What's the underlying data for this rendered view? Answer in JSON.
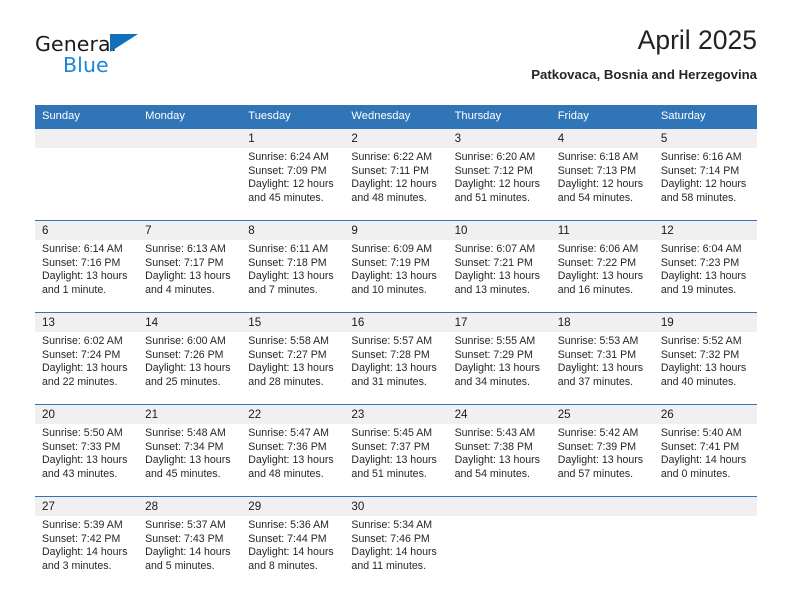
{
  "brand": {
    "name_part1": "General",
    "name_part2": "Blue",
    "triangle_icon": "triangle-icon",
    "blue_hex": "#1b86d8",
    "dark_hex": "#1b1b1b"
  },
  "header": {
    "title": "April 2025",
    "subtitle": "Patkovaca, Bosnia and Herzegovina",
    "header_bg_hex": "#3075b8",
    "daynum_bg_hex": "#f0f0f0"
  },
  "weekdays": [
    "Sunday",
    "Monday",
    "Tuesday",
    "Wednesday",
    "Thursday",
    "Friday",
    "Saturday"
  ],
  "weeks": [
    [
      {
        "day": "",
        "sunrise": "",
        "sunset": "",
        "daylight": ""
      },
      {
        "day": "",
        "sunrise": "",
        "sunset": "",
        "daylight": ""
      },
      {
        "day": "1",
        "sunrise": "Sunrise: 6:24 AM",
        "sunset": "Sunset: 7:09 PM",
        "daylight": "Daylight: 12 hours and 45 minutes."
      },
      {
        "day": "2",
        "sunrise": "Sunrise: 6:22 AM",
        "sunset": "Sunset: 7:11 PM",
        "daylight": "Daylight: 12 hours and 48 minutes."
      },
      {
        "day": "3",
        "sunrise": "Sunrise: 6:20 AM",
        "sunset": "Sunset: 7:12 PM",
        "daylight": "Daylight: 12 hours and 51 minutes."
      },
      {
        "day": "4",
        "sunrise": "Sunrise: 6:18 AM",
        "sunset": "Sunset: 7:13 PM",
        "daylight": "Daylight: 12 hours and 54 minutes."
      },
      {
        "day": "5",
        "sunrise": "Sunrise: 6:16 AM",
        "sunset": "Sunset: 7:14 PM",
        "daylight": "Daylight: 12 hours and 58 minutes."
      }
    ],
    [
      {
        "day": "6",
        "sunrise": "Sunrise: 6:14 AM",
        "sunset": "Sunset: 7:16 PM",
        "daylight": "Daylight: 13 hours and 1 minute."
      },
      {
        "day": "7",
        "sunrise": "Sunrise: 6:13 AM",
        "sunset": "Sunset: 7:17 PM",
        "daylight": "Daylight: 13 hours and 4 minutes."
      },
      {
        "day": "8",
        "sunrise": "Sunrise: 6:11 AM",
        "sunset": "Sunset: 7:18 PM",
        "daylight": "Daylight: 13 hours and 7 minutes."
      },
      {
        "day": "9",
        "sunrise": "Sunrise: 6:09 AM",
        "sunset": "Sunset: 7:19 PM",
        "daylight": "Daylight: 13 hours and 10 minutes."
      },
      {
        "day": "10",
        "sunrise": "Sunrise: 6:07 AM",
        "sunset": "Sunset: 7:21 PM",
        "daylight": "Daylight: 13 hours and 13 minutes."
      },
      {
        "day": "11",
        "sunrise": "Sunrise: 6:06 AM",
        "sunset": "Sunset: 7:22 PM",
        "daylight": "Daylight: 13 hours and 16 minutes."
      },
      {
        "day": "12",
        "sunrise": "Sunrise: 6:04 AM",
        "sunset": "Sunset: 7:23 PM",
        "daylight": "Daylight: 13 hours and 19 minutes."
      }
    ],
    [
      {
        "day": "13",
        "sunrise": "Sunrise: 6:02 AM",
        "sunset": "Sunset: 7:24 PM",
        "daylight": "Daylight: 13 hours and 22 minutes."
      },
      {
        "day": "14",
        "sunrise": "Sunrise: 6:00 AM",
        "sunset": "Sunset: 7:26 PM",
        "daylight": "Daylight: 13 hours and 25 minutes."
      },
      {
        "day": "15",
        "sunrise": "Sunrise: 5:58 AM",
        "sunset": "Sunset: 7:27 PM",
        "daylight": "Daylight: 13 hours and 28 minutes."
      },
      {
        "day": "16",
        "sunrise": "Sunrise: 5:57 AM",
        "sunset": "Sunset: 7:28 PM",
        "daylight": "Daylight: 13 hours and 31 minutes."
      },
      {
        "day": "17",
        "sunrise": "Sunrise: 5:55 AM",
        "sunset": "Sunset: 7:29 PM",
        "daylight": "Daylight: 13 hours and 34 minutes."
      },
      {
        "day": "18",
        "sunrise": "Sunrise: 5:53 AM",
        "sunset": "Sunset: 7:31 PM",
        "daylight": "Daylight: 13 hours and 37 minutes."
      },
      {
        "day": "19",
        "sunrise": "Sunrise: 5:52 AM",
        "sunset": "Sunset: 7:32 PM",
        "daylight": "Daylight: 13 hours and 40 minutes."
      }
    ],
    [
      {
        "day": "20",
        "sunrise": "Sunrise: 5:50 AM",
        "sunset": "Sunset: 7:33 PM",
        "daylight": "Daylight: 13 hours and 43 minutes."
      },
      {
        "day": "21",
        "sunrise": "Sunrise: 5:48 AM",
        "sunset": "Sunset: 7:34 PM",
        "daylight": "Daylight: 13 hours and 45 minutes."
      },
      {
        "day": "22",
        "sunrise": "Sunrise: 5:47 AM",
        "sunset": "Sunset: 7:36 PM",
        "daylight": "Daylight: 13 hours and 48 minutes."
      },
      {
        "day": "23",
        "sunrise": "Sunrise: 5:45 AM",
        "sunset": "Sunset: 7:37 PM",
        "daylight": "Daylight: 13 hours and 51 minutes."
      },
      {
        "day": "24",
        "sunrise": "Sunrise: 5:43 AM",
        "sunset": "Sunset: 7:38 PM",
        "daylight": "Daylight: 13 hours and 54 minutes."
      },
      {
        "day": "25",
        "sunrise": "Sunrise: 5:42 AM",
        "sunset": "Sunset: 7:39 PM",
        "daylight": "Daylight: 13 hours and 57 minutes."
      },
      {
        "day": "26",
        "sunrise": "Sunrise: 5:40 AM",
        "sunset": "Sunset: 7:41 PM",
        "daylight": "Daylight: 14 hours and 0 minutes."
      }
    ],
    [
      {
        "day": "27",
        "sunrise": "Sunrise: 5:39 AM",
        "sunset": "Sunset: 7:42 PM",
        "daylight": "Daylight: 14 hours and 3 minutes."
      },
      {
        "day": "28",
        "sunrise": "Sunrise: 5:37 AM",
        "sunset": "Sunset: 7:43 PM",
        "daylight": "Daylight: 14 hours and 5 minutes."
      },
      {
        "day": "29",
        "sunrise": "Sunrise: 5:36 AM",
        "sunset": "Sunset: 7:44 PM",
        "daylight": "Daylight: 14 hours and 8 minutes."
      },
      {
        "day": "30",
        "sunrise": "Sunrise: 5:34 AM",
        "sunset": "Sunset: 7:46 PM",
        "daylight": "Daylight: 14 hours and 11 minutes."
      },
      {
        "day": "",
        "sunrise": "",
        "sunset": "",
        "daylight": ""
      },
      {
        "day": "",
        "sunrise": "",
        "sunset": "",
        "daylight": ""
      },
      {
        "day": "",
        "sunrise": "",
        "sunset": "",
        "daylight": ""
      }
    ]
  ]
}
